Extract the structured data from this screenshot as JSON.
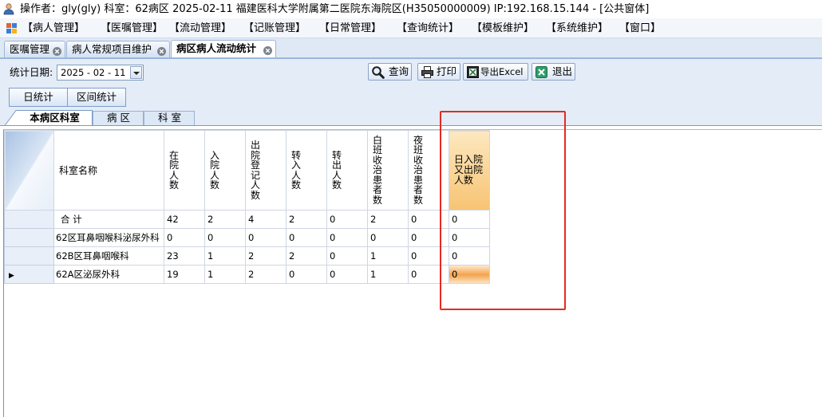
{
  "window": {
    "title": "操作者：gly(gly)  科室：62病区  2025-02-11  福建医科大学附属第二医院东海院区(H35050000009) IP:192.168.15.144 - [公共窗体]"
  },
  "menu": {
    "items": [
      "【病人管理】",
      "【医嘱管理】",
      "【流动管理】",
      "【记账管理】",
      "【日常管理】",
      "【查询统计】",
      "【模板维护】",
      "【系统维护】",
      "【窗口】"
    ]
  },
  "doc_tabs": [
    {
      "label": "医嘱管理",
      "active": false
    },
    {
      "label": "病人常规项目维护",
      "active": false
    },
    {
      "label": "病区病人流动统计",
      "active": true
    }
  ],
  "toolbar": {
    "date_label": "统计日期:",
    "date_value": "2025 - 02 - 11",
    "buttons": {
      "query": "查询",
      "print": "打印",
      "export": "导出Excel",
      "exit": "退出"
    }
  },
  "mode_buttons": [
    "日统计",
    "区间统计"
  ],
  "sub_tabs": [
    {
      "label": "本病区科室",
      "active": true
    },
    {
      "label": "病 区",
      "active": false
    },
    {
      "label": "科 室",
      "active": false
    }
  ],
  "grid": {
    "columns": [
      {
        "label": "科室名称"
      },
      {
        "label": "在院人数"
      },
      {
        "label": "入院人数"
      },
      {
        "label": "出院登记人数"
      },
      {
        "label": "转入人数"
      },
      {
        "label": "转出人数"
      },
      {
        "label": "白班收治患者数"
      },
      {
        "label": "夜班收治患者数"
      },
      {
        "label": "日入院又出院人数",
        "highlighted": true
      }
    ],
    "rows": [
      {
        "name": "合 计",
        "values": [
          42,
          2,
          4,
          2,
          0,
          2,
          0,
          0
        ],
        "total": true,
        "current": false
      },
      {
        "name": "62区耳鼻咽喉科泌尿外科",
        "values": [
          0,
          0,
          0,
          0,
          0,
          0,
          0,
          0
        ],
        "current": false
      },
      {
        "name": "62B区耳鼻咽喉科",
        "values": [
          23,
          1,
          2,
          2,
          0,
          1,
          0,
          0
        ],
        "current": false
      },
      {
        "name": "62A区泌尿外科",
        "values": [
          19,
          1,
          2,
          0,
          0,
          1,
          0,
          0
        ],
        "current": true
      }
    ],
    "current_row_marker": "▶"
  },
  "icons": {
    "app": "user-icon",
    "menu": "window-grid-icon",
    "tab_close": "close-circle-icon",
    "query": "search-icon",
    "print": "printer-icon",
    "export": "excel-icon",
    "exit": "exit-icon",
    "date_dropdown": "chevron-down-icon"
  },
  "colors": {
    "highlight_header": "#f7c373",
    "highlight_cell": "#f3a34f",
    "annotation_box": "#e32b22",
    "tab_strip": "#dfe8f5",
    "toolbar_bg": "#e4ecf7"
  }
}
